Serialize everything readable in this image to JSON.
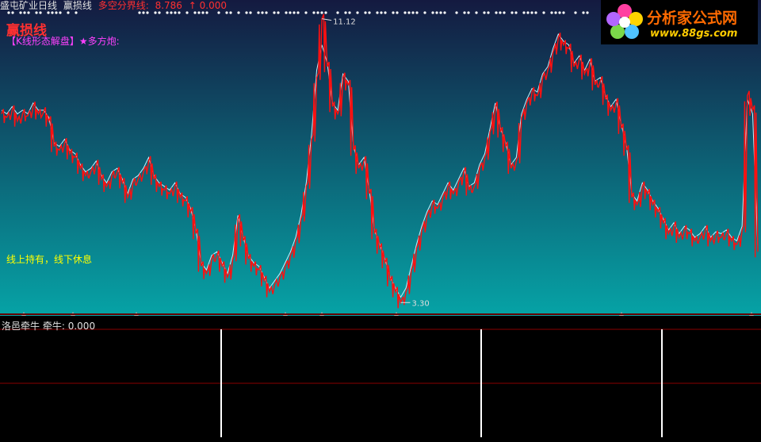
{
  "header": {
    "stock_name": "盛屯矿业日线",
    "indicator_name": "赢损线",
    "boundary_label": "多空分界线:",
    "boundary_value": "8.786",
    "boundary_arrow": "↑",
    "boundary_extra": "0.000"
  },
  "overlay": {
    "big_title": "赢损线",
    "tagline": "【K线形态解盘】★多方炮:",
    "hint": "线上持有，线下休息"
  },
  "logo": {
    "brand": "分析家公式网",
    "url": "www.88gs.com"
  },
  "sub_panel": {
    "name": "洛邑牵牛",
    "series_label": "牵牛:",
    "series_value": "0.000"
  },
  "colors": {
    "bg_top": "#141a40",
    "bg_bottom": "#06a3a6",
    "line_main": "#ff1010",
    "line_highlight": "#c0f0ff",
    "header_text": "#e0e0e0",
    "boundary_text": "#ff3030",
    "sub_bar": "#ffffff",
    "sub_divider": "#8a0000"
  },
  "chart_data": {
    "type": "line",
    "title": "",
    "xlabel": "",
    "ylabel": "",
    "ylim": [
      3.0,
      11.2
    ],
    "annotations": [
      {
        "label": "11.12",
        "at": "peak"
      },
      {
        "label": "3.30",
        "at": "trough"
      }
    ],
    "series": [
      {
        "values": [
          8.5,
          8.4,
          8.6,
          8.3,
          8.5,
          8.45,
          8.7,
          8.5,
          8.55,
          8.3,
          7.6,
          7.5,
          7.7,
          7.4,
          7.3,
          7.0,
          6.8,
          6.9,
          7.1,
          6.7,
          6.5,
          6.8,
          6.9,
          6.6,
          6.2,
          6.6,
          6.7,
          6.9,
          7.2,
          6.7,
          6.5,
          6.4,
          6.3,
          6.5,
          6.2,
          6.1,
          5.8,
          5.2,
          4.3,
          4.1,
          4.5,
          4.6,
          4.3,
          4.0,
          4.5,
          5.6,
          5.0,
          4.5,
          4.3,
          4.2,
          3.9,
          3.6,
          3.8,
          4.0,
          4.3,
          4.6,
          5.0,
          5.6,
          6.5,
          7.8,
          9.5,
          11.12,
          9.8,
          8.7,
          8.5,
          9.5,
          9.3,
          7.5,
          7.0,
          7.2,
          6.3,
          5.2,
          4.8,
          4.4,
          3.9,
          3.6,
          3.3,
          3.6,
          4.2,
          4.8,
          5.3,
          5.7,
          6.0,
          5.9,
          6.2,
          6.5,
          6.3,
          6.6,
          6.9,
          6.4,
          6.5,
          7.0,
          7.3,
          8.0,
          8.7,
          8.0,
          7.6,
          7.0,
          7.2,
          8.4,
          8.8,
          9.1,
          9.0,
          9.5,
          9.7,
          10.2,
          10.6,
          10.4,
          10.3,
          9.8,
          10.0,
          9.6,
          9.9,
          9.3,
          9.4,
          8.9,
          8.6,
          8.8,
          8.1,
          7.5,
          6.2,
          6.0,
          6.5,
          6.3,
          6.0,
          5.8,
          5.5,
          5.2,
          5.4,
          5.1,
          5.3,
          5.2,
          5.0,
          5.1,
          5.3,
          5.0,
          5.15,
          5.1,
          5.2,
          5.0,
          4.9,
          5.3,
          9.0,
          8.6,
          4.7
        ]
      },
      {
        "values": [
          8.6,
          8.5,
          8.7,
          8.5,
          8.6,
          8.5,
          8.8,
          8.6,
          8.6,
          8.4,
          7.7,
          7.6,
          7.8,
          7.5,
          7.4,
          7.1,
          6.9,
          7.0,
          7.2,
          6.8,
          6.6,
          6.9,
          7.0,
          6.7,
          6.3,
          6.7,
          6.8,
          7.0,
          7.3,
          6.8,
          6.6,
          6.5,
          6.4,
          6.6,
          6.3,
          6.2,
          5.9,
          5.3,
          4.4,
          4.2,
          4.6,
          4.7,
          4.4,
          4.1,
          4.6,
          5.7,
          5.1,
          4.6,
          4.4,
          4.3,
          4.0,
          3.7,
          3.9,
          4.1,
          4.4,
          4.7,
          5.1,
          5.7,
          6.6,
          7.9,
          9.7,
          10.4,
          9.9,
          8.8,
          8.6,
          9.6,
          9.4,
          7.6,
          7.1,
          7.3,
          6.4,
          5.3,
          4.9,
          4.5,
          4.0,
          3.7,
          3.45,
          3.7,
          4.3,
          4.9,
          5.4,
          5.8,
          6.1,
          6.0,
          6.3,
          6.6,
          6.4,
          6.7,
          7.0,
          6.5,
          6.6,
          7.1,
          7.4,
          8.1,
          8.8,
          8.1,
          7.7,
          7.1,
          7.3,
          8.5,
          8.9,
          9.2,
          9.1,
          9.6,
          9.8,
          10.3,
          10.7,
          10.5,
          10.4,
          9.9,
          10.1,
          9.7,
          10.0,
          9.4,
          9.5,
          9.0,
          8.7,
          8.9,
          8.2,
          7.6,
          6.3,
          6.1,
          6.6,
          6.4,
          6.1,
          5.9,
          5.6,
          5.3,
          5.5,
          5.2,
          5.4,
          5.3,
          5.1,
          5.2,
          5.4,
          5.1,
          5.25,
          5.2,
          5.3,
          5.1,
          5.0,
          5.4,
          8.9,
          8.5,
          4.8
        ]
      }
    ],
    "sub_values": [
      0,
      1,
      0,
      1,
      0
    ]
  }
}
